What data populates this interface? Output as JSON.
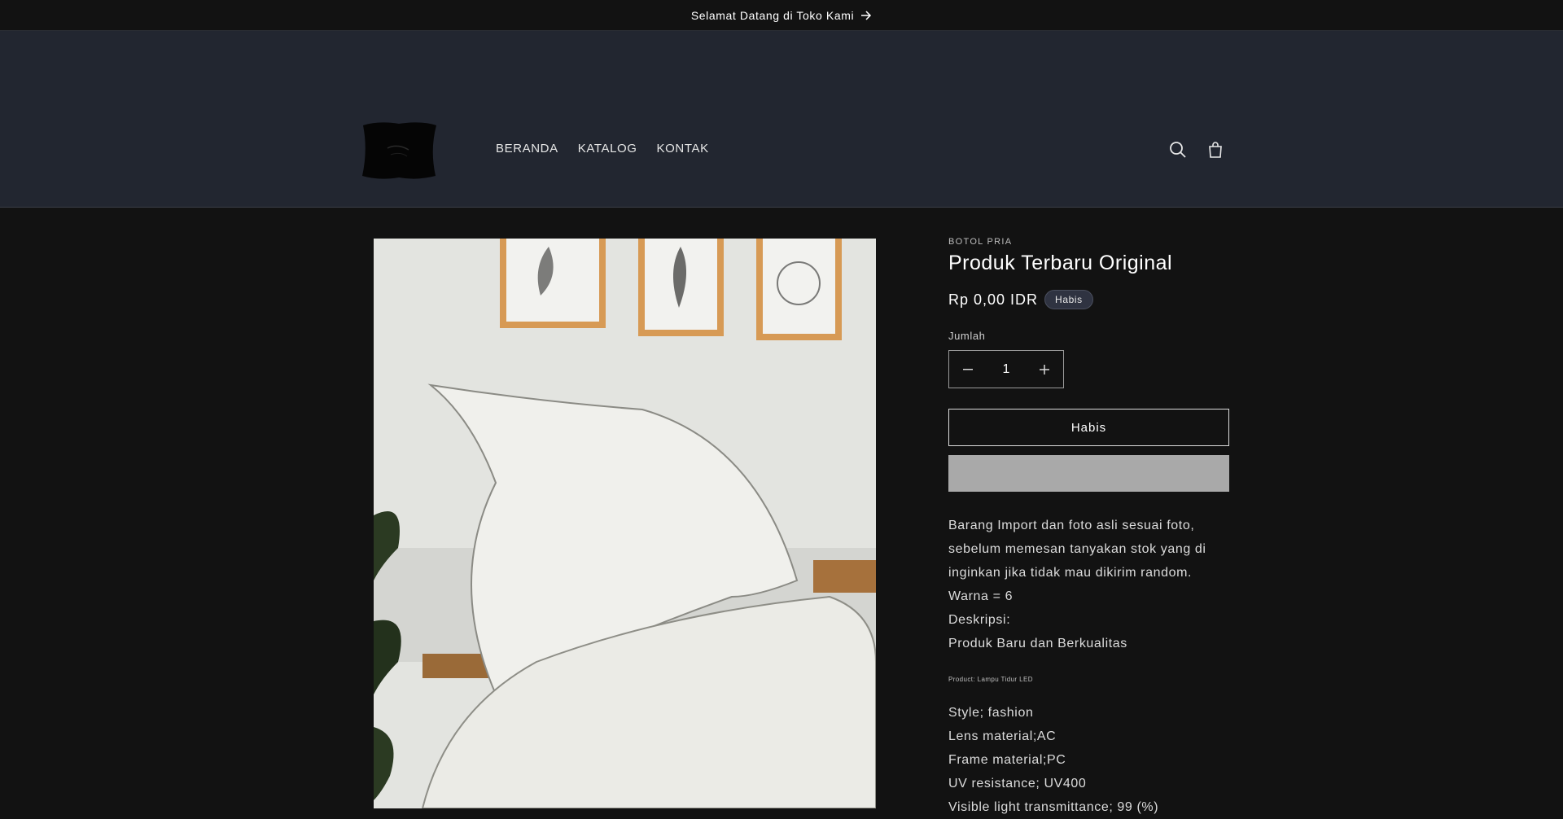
{
  "announcement": {
    "text": "Selamat Datang di Toko Kami"
  },
  "nav": {
    "items": [
      "BERANDA",
      "KATALOG",
      "KONTAK"
    ]
  },
  "header": {
    "icons": [
      "search-icon",
      "cart-icon"
    ]
  },
  "product": {
    "vendor": "BOTOL PRIA",
    "title": "Produk Terbaru Original",
    "price": "Rp 0,00 IDR",
    "badge": "Habis",
    "quantity_label": "Jumlah",
    "quantity": "1",
    "sold_out_label": "Habis",
    "description": [
      "Barang Import dan foto asli sesuai foto, sebelum memesan tanyakan stok yang di inginkan jika tidak mau dikirim random.",
      "Warna = 6",
      "Deskripsi:",
      "Produk Baru dan Berkualitas"
    ],
    "small_note": "Product: Lampu Tidur LED",
    "specs": [
      "Style; fashion",
      "Lens material;AC",
      "Frame material;PC",
      "UV resistance; UV400",
      "Visible light transmittance; 99 (%)"
    ]
  },
  "colors": {
    "background": "#121212",
    "header": "#222630",
    "buy_now_disabled": "#a9a9a9"
  }
}
